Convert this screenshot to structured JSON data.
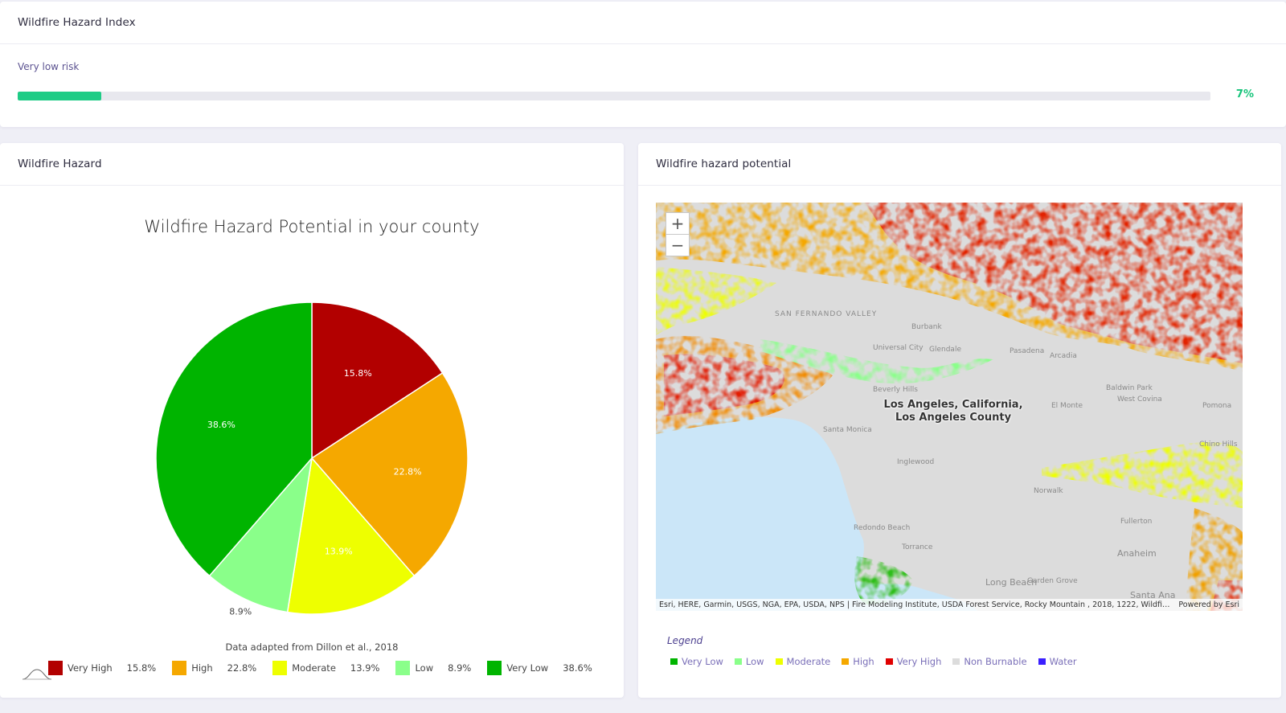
{
  "index_panel": {
    "title": "Wildfire Hazard Index",
    "risk_label": "Very low risk",
    "risk_fraction": 0.07,
    "risk_value_text": "7%",
    "bar_color": "#1fcc86",
    "value_color": "#15c47a"
  },
  "hazard_panel": {
    "title": "Wildfire Hazard",
    "source_note": "Data adapted from Dillon et al., 2018",
    "curve_icon": "bell-curve-icon",
    "chart_data": {
      "type": "pie",
      "title": "Wildfire Hazard Potential in your county",
      "slices": [
        {
          "label": "Very High",
          "value": 15.8,
          "text": "15.8%",
          "color": "#b20000"
        },
        {
          "label": "High",
          "value": 22.8,
          "text": "22.8%",
          "color": "#f5a800"
        },
        {
          "label": "Moderate",
          "value": 13.9,
          "text": "13.9%",
          "color": "#eeff00"
        },
        {
          "label": "Low",
          "value": 8.9,
          "text": "8.9%",
          "color": "#8aff8a"
        },
        {
          "label": "Very Low",
          "value": 38.6,
          "text": "38.6%",
          "color": "#00b400"
        }
      ],
      "start_angle_deg": 0,
      "direction": "clockwise",
      "legend_position": "bottom"
    }
  },
  "map_panel": {
    "title": "Wildfire hazard potential",
    "zoom_in": "+",
    "zoom_out": "−",
    "place_label": "Los Angeles, California, Los Angeles County",
    "attribution": "Esri, HERE, Garmin, USGS, NGA, EPA, USDA, NPS | Fire Modeling Institute, USDA Forest Service, Rocky Mountain , 2018, 1222, Wildfir...",
    "powered_by": "Powered by Esri",
    "map_labels": [
      "Santa Monica",
      "Beverly Hills",
      "Inglewood",
      "Glendale",
      "Pasadena",
      "Arcadia",
      "Baldwin Park",
      "West Covina",
      "El Monte",
      "Pomona",
      "Anaheim",
      "Fullerton",
      "Santa Ana",
      "Redondo Beach",
      "Torrance",
      "Long Beach",
      "Garden Grove",
      "Norwalk",
      "Universal City",
      "Burbank",
      "SAN FERNANDO VALLEY",
      "Chino Hills"
    ],
    "legend_title": "Legend",
    "legend": [
      {
        "label": "Very Low",
        "color": "#00b400"
      },
      {
        "label": "Low",
        "color": "#8aff8a"
      },
      {
        "label": "Moderate",
        "color": "#eeff00"
      },
      {
        "label": "High",
        "color": "#f5a800"
      },
      {
        "label": "Very High",
        "color": "#e00000"
      },
      {
        "label": "Non Burnable",
        "color": "#dcdcdc"
      },
      {
        "label": "Water",
        "color": "#3a1fff"
      }
    ]
  }
}
